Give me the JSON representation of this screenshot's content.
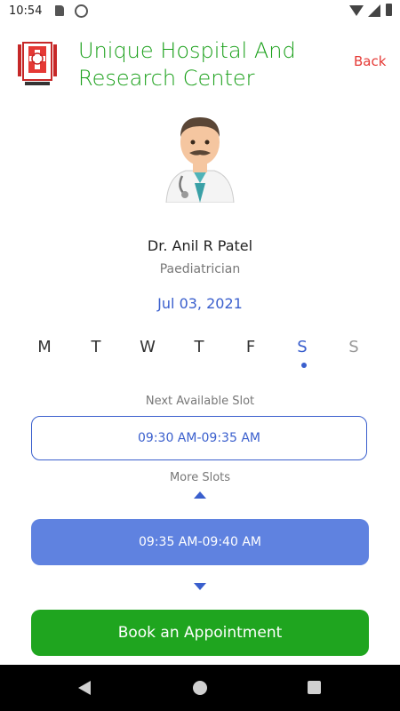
{
  "status_bar": {
    "time": "10:54"
  },
  "header": {
    "hospital_name": "Unique Hospital And Research Center",
    "back_label": "Back"
  },
  "doctor": {
    "name": "Dr. Anil R Patel",
    "specialization": "Paediatrician"
  },
  "selected_date": "Jul 03, 2021",
  "week": {
    "days": [
      "M",
      "T",
      "W",
      "T",
      "F",
      "S",
      "S"
    ],
    "selected_index": 5
  },
  "slots": {
    "next_label": "Next Available Slot",
    "next_slot": "09:30 AM-09:35 AM",
    "more_label": "More Slots",
    "selected_slot": "09:35 AM-09:40 AM"
  },
  "book_button_label": "Book an Appointment",
  "colors": {
    "brand_green": "#1aa01a",
    "accent_blue": "#3a5fcd",
    "slot_blue": "#5f82e0",
    "back_red": "#e53935"
  }
}
